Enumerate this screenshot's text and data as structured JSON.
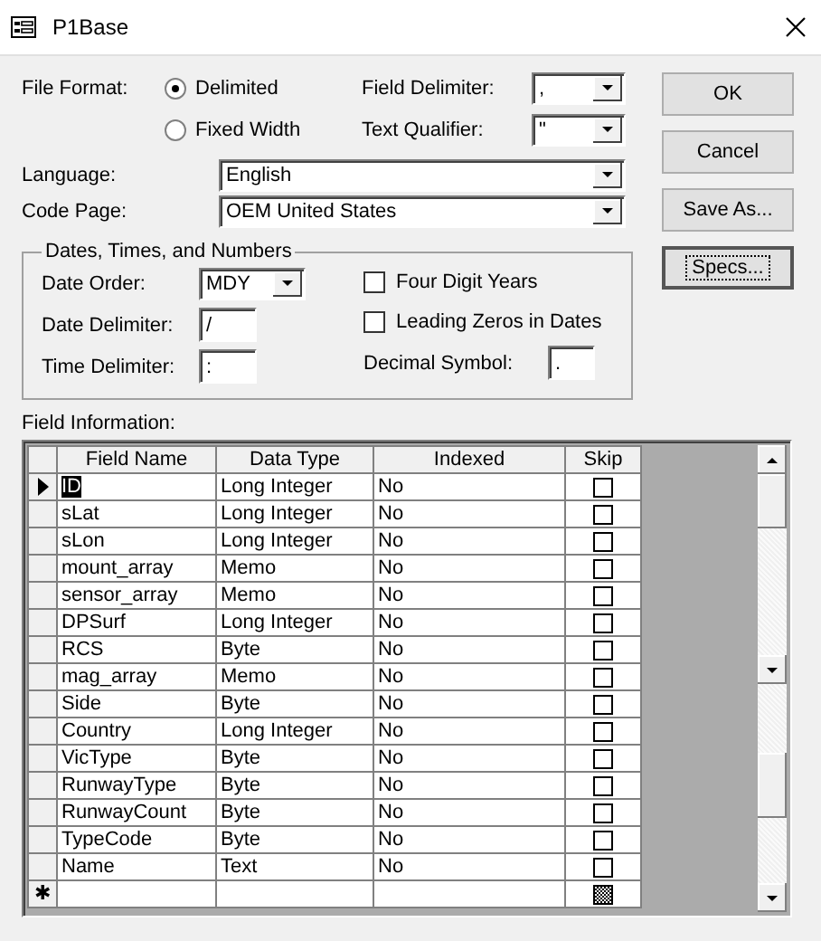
{
  "window": {
    "title": "P1Base"
  },
  "file_format": {
    "label": "File Format:",
    "options": [
      {
        "label": "Delimited",
        "selected": true
      },
      {
        "label": "Fixed Width",
        "selected": false
      }
    ]
  },
  "field_delimiter": {
    "label": "Field Delimiter:",
    "value": ","
  },
  "text_qualifier": {
    "label": "Text Qualifier:",
    "value": "\""
  },
  "language": {
    "label": "Language:",
    "value": "English"
  },
  "code_page": {
    "label": "Code Page:",
    "value": "OEM United States"
  },
  "dates_group": {
    "title": "Dates, Times, and Numbers",
    "date_order": {
      "label": "Date Order:",
      "value": "MDY"
    },
    "date_delimiter": {
      "label": "Date Delimiter:",
      "value": "/"
    },
    "time_delimiter": {
      "label": "Time Delimiter:",
      "value": ":"
    },
    "checkboxes": [
      {
        "label": "Four Digit Years",
        "checked": false
      },
      {
        "label": "Leading Zeros in Dates",
        "checked": false
      }
    ],
    "decimal_symbol": {
      "label": "Decimal Symbol:",
      "value": "."
    }
  },
  "buttons": [
    {
      "label": "OK",
      "focused": false
    },
    {
      "label": "Cancel",
      "focused": false
    },
    {
      "label": "Save As...",
      "focused": false
    },
    {
      "label": "Specs...",
      "focused": true
    }
  ],
  "field_information": {
    "label": "Field Information:",
    "columns": [
      "Field Name",
      "Data Type",
      "Indexed",
      "Skip"
    ],
    "rows": [
      {
        "kind": "field",
        "field_name": "ID",
        "data_type": "Long Integer",
        "indexed": "No",
        "skip": false,
        "current": true
      },
      {
        "kind": "field",
        "field_name": "sLat",
        "data_type": "Long Integer",
        "indexed": "No",
        "skip": false,
        "current": false
      },
      {
        "kind": "field",
        "field_name": "sLon",
        "data_type": "Long Integer",
        "indexed": "No",
        "skip": false,
        "current": false
      },
      {
        "kind": "field",
        "field_name": "mount_array",
        "data_type": "Memo",
        "indexed": "No",
        "skip": false,
        "current": false
      },
      {
        "kind": "field",
        "field_name": "sensor_array",
        "data_type": "Memo",
        "indexed": "No",
        "skip": false,
        "current": false
      },
      {
        "kind": "field",
        "field_name": "DPSurf",
        "data_type": "Long Integer",
        "indexed": "No",
        "skip": false,
        "current": false
      },
      {
        "kind": "field",
        "field_name": "RCS",
        "data_type": "Byte",
        "indexed": "No",
        "skip": false,
        "current": false
      },
      {
        "kind": "field",
        "field_name": "mag_array",
        "data_type": "Memo",
        "indexed": "No",
        "skip": false,
        "current": false
      },
      {
        "kind": "field",
        "field_name": "Side",
        "data_type": "Byte",
        "indexed": "No",
        "skip": false,
        "current": false
      },
      {
        "kind": "field",
        "field_name": "Country",
        "data_type": "Long Integer",
        "indexed": "No",
        "skip": false,
        "current": false
      },
      {
        "kind": "field",
        "field_name": "VicType",
        "data_type": "Byte",
        "indexed": "No",
        "skip": false,
        "current": false
      },
      {
        "kind": "field",
        "field_name": "RunwayType",
        "data_type": "Byte",
        "indexed": "No",
        "skip": false,
        "current": false
      },
      {
        "kind": "field",
        "field_name": "RunwayCount",
        "data_type": "Byte",
        "indexed": "No",
        "skip": false,
        "current": false
      },
      {
        "kind": "field",
        "field_name": "TypeCode",
        "data_type": "Byte",
        "indexed": "No",
        "skip": false,
        "current": false
      },
      {
        "kind": "field",
        "field_name": "Name",
        "data_type": "Text",
        "indexed": "No",
        "skip": false,
        "current": false
      },
      {
        "kind": "new",
        "marker": "✱",
        "skip_disabled": true
      }
    ]
  }
}
